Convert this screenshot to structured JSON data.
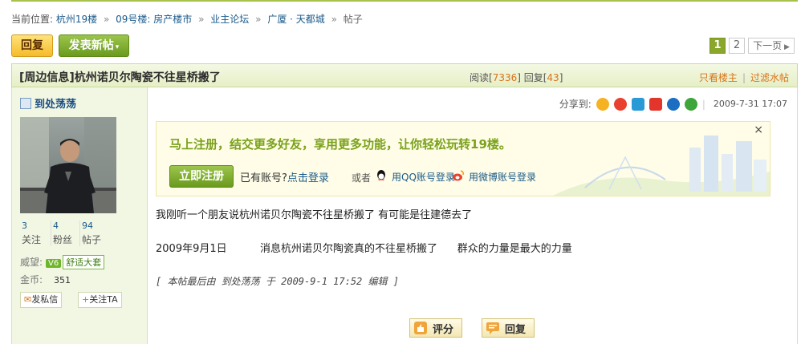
{
  "breadcrumb": {
    "prefix": "当前位置:",
    "items": [
      "杭州19楼",
      "09号楼: 房产楼市",
      "业主论坛",
      "广厦 · 天都城"
    ],
    "current": "帖子",
    "sep": "»"
  },
  "toolbar": {
    "reply_label": "回复",
    "newpost_label": "发表新帖",
    "caret": "▾"
  },
  "pager": {
    "page1": "1",
    "page2": "2",
    "next_label": "下一页"
  },
  "thread": {
    "title": "[周边信息]杭州诺贝尔陶瓷不往星桥搬了",
    "read_label": "阅读[",
    "read_count": "7336",
    "reply_label": "] 回复[",
    "reply_count": "43",
    "close_bracket": "]",
    "only_op": "只看楼主",
    "filter": "过滤水帖",
    "bar": "|"
  },
  "author": {
    "name": "到处荡荡",
    "follow_count": "3",
    "follow_label": "关注",
    "fans_count": "4",
    "fans_label": "粉丝",
    "posts_count": "94",
    "posts_label": "帖子",
    "prestige_label": "威望:",
    "vlevel": "V6",
    "rank": "舒适大套",
    "coins_label": "金币:",
    "coins_value": "351",
    "pm_label": "发私信",
    "follow_btn": "关注TA",
    "pm_icon": "✉",
    "plus": "+"
  },
  "post": {
    "share_label": "分享到:",
    "date": "2009-7-31 17:07",
    "bar": "|",
    "register": {
      "message": "马上注册，结交更多好友，享用更多功能，让你轻松玩转19楼。",
      "register_btn": "立即注册",
      "have_account": "已有账号?",
      "login_link": "点击登录",
      "or": "或者",
      "qq_login": "用QQ账号登录",
      "weibo_login": "用微博账号登录",
      "close": "×"
    },
    "line1": "我刚听一个朋友说杭州诺贝尔陶瓷不往星桥搬了   有可能是往建德去了",
    "line2": "2009年9月1日          消息杭州诺贝尔陶瓷真的不往星桥搬了      群众的力量是最大的力量",
    "edit_note": "[ 本帖最后由 到处荡荡 于 2009-9-1 17:52 编辑 ]",
    "rate_label": "评分",
    "reply_label": "回复"
  },
  "colors": {
    "accent_green": "#8aa62b",
    "link_blue": "#1a5a8a",
    "orange": "#d9731a"
  }
}
